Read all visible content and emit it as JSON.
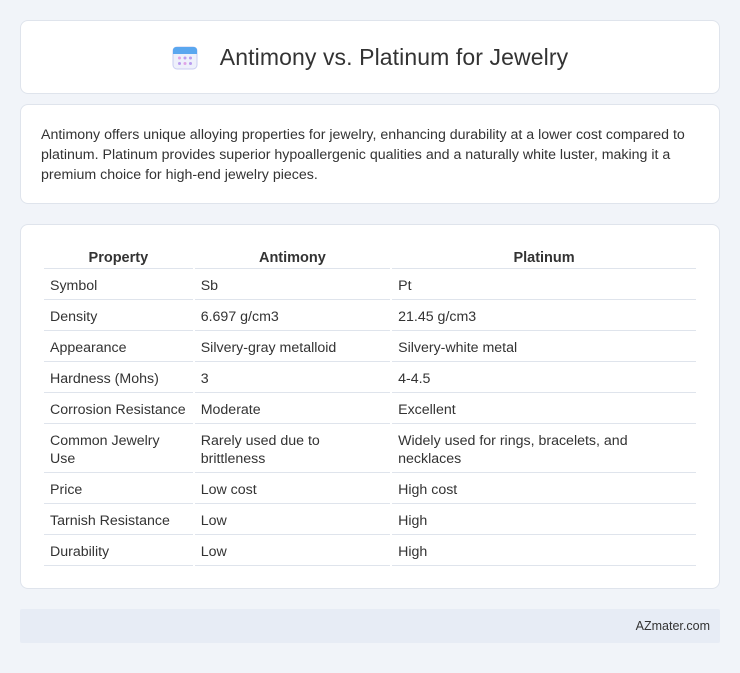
{
  "header": {
    "title": "Antimony vs. Platinum for Jewelry",
    "icon": "calendar-icon"
  },
  "intro": {
    "text": "Antimony offers unique alloying properties for jewelry, enhancing durability at a lower cost compared to platinum. Platinum provides superior hypoallergenic qualities and a naturally white luster, making it a premium choice for high-end jewelry pieces."
  },
  "table": {
    "headers": [
      "Property",
      "Antimony",
      "Platinum"
    ],
    "rows": [
      [
        "Symbol",
        "Sb",
        "Pt"
      ],
      [
        "Density",
        "6.697 g/cm3",
        "21.45 g/cm3"
      ],
      [
        "Appearance",
        "Silvery-gray metalloid",
        "Silvery-white metal"
      ],
      [
        "Hardness (Mohs)",
        "3",
        "4-4.5"
      ],
      [
        "Corrosion Resistance",
        "Moderate",
        "Excellent"
      ],
      [
        "Common Jewelry Use",
        "Rarely used due to brittleness",
        "Widely used for rings, bracelets, and necklaces"
      ],
      [
        "Price",
        "Low cost",
        "High cost"
      ],
      [
        "Tarnish Resistance",
        "Low",
        "High"
      ],
      [
        "Durability",
        "Low",
        "High"
      ]
    ]
  },
  "footer": {
    "site": "AZmater.com"
  }
}
